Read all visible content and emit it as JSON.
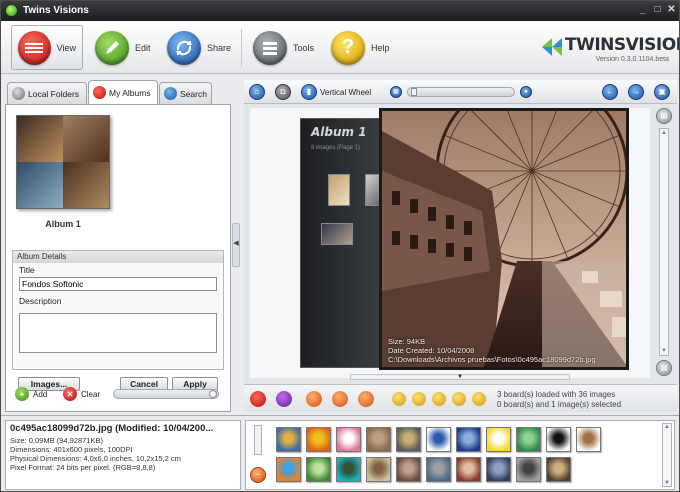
{
  "window": {
    "title": "Twins Visions"
  },
  "toolbar": {
    "view": "View",
    "edit": "Edit",
    "share": "Share",
    "tools": "Tools",
    "help": "Help",
    "logo": "TWINSVISIONS",
    "version": "Version 0.3.0.1104.beta"
  },
  "tabs": {
    "local": "Local Folders",
    "albums": "My Albums",
    "search": "Search"
  },
  "album": {
    "name": "Album 1"
  },
  "details": {
    "header": "Album Details",
    "title_label": "Title",
    "title_value": "Fondos Softonic",
    "desc_label": "Description",
    "desc_value": "",
    "images_btn": "Images...",
    "cancel_btn": "Cancel",
    "apply_btn": "Apply"
  },
  "leftfoot": {
    "add": "Add",
    "clear": "Clear"
  },
  "viewer": {
    "mode_label": "Vertical Wheel",
    "album_title": "Album 1",
    "album_info": "8 images (Page 1)",
    "photo_size": "Size: 94KB",
    "photo_date": "Date Created: 10/04/2008",
    "photo_path": "C:\\Downloads\\Archivos pruebas\\Fotos\\0c495ac18099d72b.jpg"
  },
  "status": {
    "line1": "3 board(s) loaded with 36 images",
    "line2": "0 board(s) and 1 image(s) selected"
  },
  "fileinfo": {
    "name": "0c495ac18099d72b.jpg  (Modified:  10/04/200...",
    "size": "Size: 0,09MB (94,92871KB)",
    "dimensions": "Dimensions: 401x600 pixels, 100DPI",
    "physical": "Physical Dimensions: 4,0x6,0 inches, 10,2x15,2 cm",
    "format": "Pixel Format: 24 bits per pixel. (RGB=8,8,8)"
  },
  "colors": {
    "accent_red": "#c8282a",
    "accent_green": "#5aa52a",
    "accent_blue": "#2a6fc0",
    "accent_yellow": "#f4c510"
  },
  "thumbnails": [
    {
      "name": "thumb-1",
      "color1": "#3a6aa8",
      "color2": "#e0b040"
    },
    {
      "name": "thumb-2",
      "color1": "#e06010",
      "color2": "#f0c020"
    },
    {
      "name": "thumb-3",
      "color1": "#e070a0",
      "color2": "#ffffff"
    },
    {
      "name": "thumb-4",
      "color1": "#8a6a4a",
      "color2": "#c0a080"
    },
    {
      "name": "thumb-5",
      "color1": "#5a5a5a",
      "color2": "#c8b070"
    },
    {
      "name": "thumb-6",
      "color1": "#ffffff",
      "color2": "#2a5ab0"
    },
    {
      "name": "thumb-7",
      "color1": "#1a3a8a",
      "color2": "#8ab0e0"
    },
    {
      "name": "thumb-8",
      "color1": "#f6d820",
      "color2": "#ffffff"
    },
    {
      "name": "thumb-9",
      "color1": "#2a8a4a",
      "color2": "#90d090"
    },
    {
      "name": "thumb-10",
      "color1": "#ffffff",
      "color2": "#111111"
    },
    {
      "name": "thumb-11",
      "color1": "#ffffff",
      "color2": "#a07040"
    },
    {
      "name": "thumb-12",
      "color1": "#f08020",
      "color2": "#40a0e0"
    },
    {
      "name": "thumb-13",
      "color1": "#3a8a30",
      "color2": "#c0e0a0"
    },
    {
      "name": "thumb-14",
      "color1": "#20b0c0",
      "color2": "#305030"
    },
    {
      "name": "thumb-15",
      "color1": "#d0c0a0",
      "color2": "#806040"
    },
    {
      "name": "thumb-16",
      "color1": "#6a4a3a",
      "color2": "#c0a090"
    },
    {
      "name": "thumb-17",
      "color1": "#4a6a8a",
      "color2": "#a0a0a0"
    },
    {
      "name": "thumb-18",
      "color1": "#8a3a2a",
      "color2": "#e0c0a0"
    },
    {
      "name": "thumb-19",
      "color1": "#304060",
      "color2": "#90a0c0"
    },
    {
      "name": "thumb-20",
      "color1": "#a0a0a0",
      "color2": "#404040"
    },
    {
      "name": "thumb-21",
      "color1": "#504030",
      "color2": "#d0b080"
    }
  ]
}
